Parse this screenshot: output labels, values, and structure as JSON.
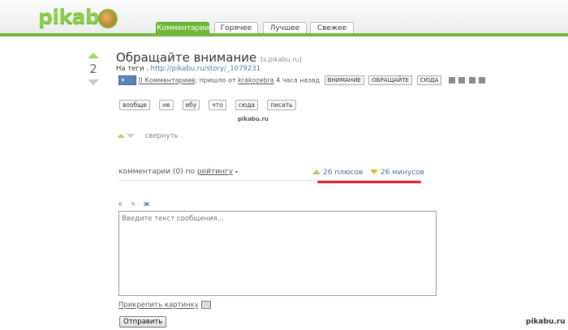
{
  "header": {
    "logo_text": "pikabu",
    "brand_color": "#6dba38",
    "tabs": [
      {
        "label": "Комментарии",
        "active": true
      },
      {
        "label": "Горячее",
        "active": false
      },
      {
        "label": "Лучшее",
        "active": false
      },
      {
        "label": "Свежее",
        "active": false
      }
    ]
  },
  "post": {
    "rating": "2",
    "title": "Обращайте внимание",
    "source": "[s.pikabu.ru]",
    "subline_prefix": "На теги .",
    "link": "http://pikabu.ru/story/_1079231",
    "comments_link": "0 Комментариев",
    "posted_prefix": "; пришло от",
    "author": "krakozebra",
    "time_ago": "4 часа назад",
    "tags": [
      "ВНИМАНИЕ",
      "ОБРАЩАЙТЕ",
      "СЮДА"
    ],
    "word_tags": [
      "вообще",
      "не",
      "ебу",
      "что",
      "сюда",
      "писать"
    ],
    "image_watermark": "pikabu.ru",
    "collapse_label": "свернуть"
  },
  "comments": {
    "count_label": "комментарии (0) по",
    "sort_label": "рейтингу",
    "plus_label": "26 плюсов",
    "minus_label": "26 минусов",
    "highlight_color": "#e0262a"
  },
  "editor": {
    "format_buttons": [
      "к",
      "ч",
      "ж"
    ],
    "placeholder": "Введите текст сообщения...",
    "attach_label": "Прикрепить картинку",
    "submit_label": "Отправить"
  },
  "corner_watermark": "pikabu.ru"
}
